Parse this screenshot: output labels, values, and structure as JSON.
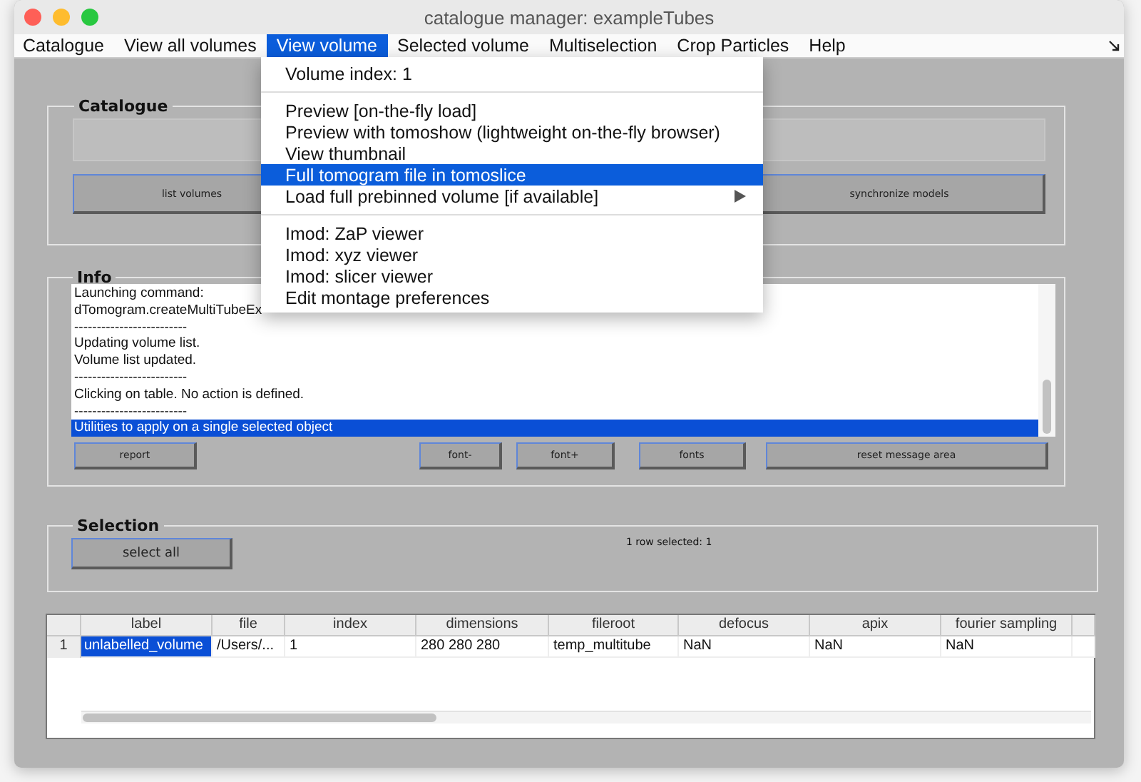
{
  "window": {
    "title": "catalogue manager: exampleTubes"
  },
  "menubar": [
    {
      "label": "Catalogue",
      "selected": false
    },
    {
      "label": "View all volumes",
      "selected": false
    },
    {
      "label": "View volume",
      "selected": true
    },
    {
      "label": "Selected volume",
      "selected": false
    },
    {
      "label": "Multiselection",
      "selected": false
    },
    {
      "label": "Crop Particles",
      "selected": false
    },
    {
      "label": "Help",
      "selected": false
    }
  ],
  "dropdown": {
    "sections": [
      [
        {
          "label": "Volume index: 1",
          "selected": false,
          "submenu": false
        }
      ],
      [
        {
          "label": "Preview [on-the-fly load]",
          "selected": false,
          "submenu": false
        },
        {
          "label": "Preview with tomoshow (lightweight on-the-fly browser)",
          "selected": false,
          "submenu": false
        },
        {
          "label": "View thumbnail",
          "selected": false,
          "submenu": false
        },
        {
          "label": "Full tomogram file in tomoslice",
          "selected": true,
          "submenu": false
        },
        {
          "label": "Load full prebinned volume [if available]",
          "selected": false,
          "submenu": true
        }
      ],
      [
        {
          "label": "Imod: ZaP viewer",
          "selected": false,
          "submenu": false
        },
        {
          "label": "Imod: xyz viewer",
          "selected": false,
          "submenu": false
        },
        {
          "label": "Imod: slicer viewer",
          "selected": false,
          "submenu": false
        },
        {
          "label": "Edit montage preferences",
          "selected": false,
          "submenu": false
        }
      ]
    ]
  },
  "catalogue_panel": {
    "title": "Catalogue",
    "buttons": [
      "list volumes",
      "synchronize models"
    ]
  },
  "info_panel": {
    "title": "Info",
    "lines": [
      {
        "text": "Launching command:",
        "selected": false
      },
      {
        "text": "dTomogram.createMultiTubeEx",
        "selected": false
      },
      {
        "text": "-------------------------",
        "selected": false
      },
      {
        "text": "Updating volume list.",
        "selected": false
      },
      {
        "text": "Volume list updated.",
        "selected": false
      },
      {
        "text": "-------------------------",
        "selected": false
      },
      {
        "text": "Clicking on table. No action is defined.",
        "selected": false
      },
      {
        "text": "-------------------------",
        "selected": false
      },
      {
        "text": "Utilities to apply on a single selected object",
        "selected": true
      }
    ],
    "buttons": [
      "report",
      "font-",
      "font+",
      "fonts",
      "reset message area"
    ]
  },
  "selection_panel": {
    "title": "Selection",
    "buttons": [
      "select all"
    ],
    "status": "1 row selected: 1"
  },
  "table": {
    "columns": [
      "label",
      "file",
      "index",
      "dimensions",
      "fileroot",
      "defocus",
      "apix",
      "fourier sampling"
    ],
    "rows": [
      {
        "number": "1",
        "cells": [
          {
            "text": "unlabelled_volume",
            "selected": true
          },
          {
            "text": "/Users/...",
            "selected": false
          },
          {
            "text": "1",
            "selected": false
          },
          {
            "text": "280 280 280",
            "selected": false
          },
          {
            "text": "temp_multitube",
            "selected": false
          },
          {
            "text": "NaN",
            "selected": false
          },
          {
            "text": "NaN",
            "selected": false
          },
          {
            "text": "NaN",
            "selected": false
          }
        ]
      }
    ]
  }
}
